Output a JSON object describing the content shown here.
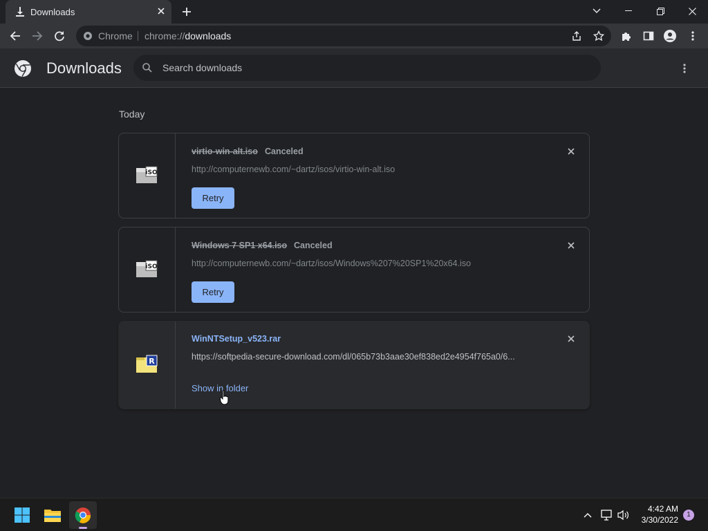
{
  "tab": {
    "title": "Downloads"
  },
  "omnibox": {
    "scheme_label": "Chrome",
    "url_prefix": "chrome://",
    "url_host": "downloads"
  },
  "header": {
    "title": "Downloads",
    "search_placeholder": "Search downloads"
  },
  "section": {
    "date": "Today"
  },
  "downloads": [
    {
      "name": "virtio-win-alt.iso",
      "status": "Canceled",
      "url": "http://computernewb.com/~dartz/isos/virtio-win-alt.iso",
      "action": "Retry",
      "icon": "iso-file-icon"
    },
    {
      "name": "Windows 7 SP1 x64.iso",
      "status": "Canceled",
      "url": "http://computernewb.com/~dartz/isos/Windows%207%20SP1%20x64.iso",
      "action": "Retry",
      "icon": "iso-file-icon"
    },
    {
      "name": "WinNTSetup_v523.rar",
      "status": "",
      "url": "https://softpedia-secure-download.com/dl/065b73b3aae30ef838ed2e4954f765a0/6...",
      "action": "Show in folder",
      "icon": "rar-file-icon"
    }
  ],
  "taskbar": {
    "time": "4:42 AM",
    "date": "3/30/2022",
    "notifications": "1"
  },
  "colors": {
    "accent": "#8ab4f8",
    "background": "#202124",
    "card_border": "#3c4043"
  }
}
